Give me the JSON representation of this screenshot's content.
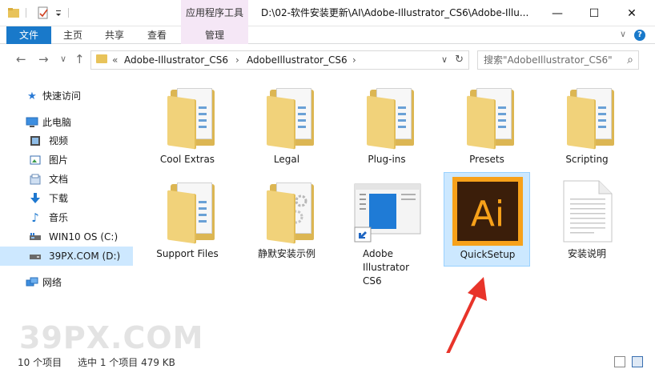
{
  "window": {
    "title_path": "D:\\02-软件安装更新\\AI\\Adobe-Illustrator_CS6\\Adobe-Illu...",
    "context_group": "应用程序工具",
    "controls": {
      "minimize": "—",
      "maximize": "☐",
      "close": "✕"
    }
  },
  "ribbon": {
    "tabs": [
      {
        "label": "文件"
      },
      {
        "label": "主页"
      },
      {
        "label": "共享"
      },
      {
        "label": "查看"
      },
      {
        "label": "管理"
      }
    ]
  },
  "nav": {
    "back": "←",
    "forward": "→",
    "recent": "∨",
    "up": "↑"
  },
  "address": {
    "overflow": "«",
    "crumbs": [
      {
        "label": "Adobe-Illustrator_CS6"
      },
      {
        "label": "AdobeIllustrator_CS6"
      }
    ],
    "separator": "›",
    "dropdown": "∨",
    "refresh": "↻"
  },
  "search": {
    "placeholder": "搜索\"AdobeIllustrator_CS6\""
  },
  "sidebar": {
    "items": [
      {
        "label": "快速访问",
        "icon": "star-icon"
      },
      {
        "label": "此电脑",
        "icon": "computer-icon"
      },
      {
        "label": "视频",
        "icon": "video-icon"
      },
      {
        "label": "图片",
        "icon": "pictures-icon"
      },
      {
        "label": "文档",
        "icon": "documents-icon"
      },
      {
        "label": "下载",
        "icon": "download-icon"
      },
      {
        "label": "音乐",
        "icon": "music-icon"
      },
      {
        "label": "WIN10 OS (C:)",
        "icon": "drive-icon"
      },
      {
        "label": "39PX.COM (D:)",
        "icon": "drive-icon"
      },
      {
        "label": "网络",
        "icon": "network-icon"
      }
    ]
  },
  "files": [
    {
      "name": "Cool Extras",
      "type": "folder"
    },
    {
      "name": "Legal",
      "type": "folder"
    },
    {
      "name": "Plug-ins",
      "type": "folder"
    },
    {
      "name": "Presets",
      "type": "folder"
    },
    {
      "name": "Scripting",
      "type": "folder"
    },
    {
      "name": "Support Files",
      "type": "folder"
    },
    {
      "name": "静默安装示例",
      "type": "folder"
    },
    {
      "name": "Adobe Illustrator CS6",
      "type": "shortcut"
    },
    {
      "name": "QuickSetup",
      "type": "app",
      "icon_text": "Ai"
    },
    {
      "name": "安装说明",
      "type": "text"
    }
  ],
  "status": {
    "count": "10 个项目",
    "selection": "选中 1 个项目  479 KB"
  },
  "watermark": "39PX.COM",
  "colors": {
    "accent": "#1979ca",
    "context_tab": "#f5e7f6",
    "selection": "#cce8ff",
    "ai_orange": "#f7a11a",
    "ai_dark": "#3b1e0a",
    "arrow": "#e8342a"
  }
}
